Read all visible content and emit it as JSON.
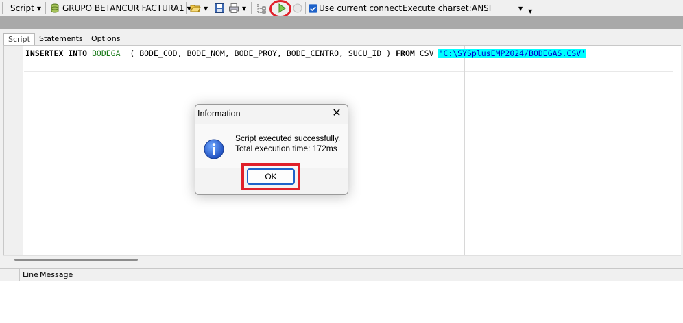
{
  "toolbar": {
    "script_menu": "Script",
    "database_name": "GRUPO BETANCUR FACTURA1",
    "use_current_connect": "Use current connect",
    "execute_charset_label": "Execute charset:",
    "charset_value": "ANSI",
    "highlight_color": "#e0202a"
  },
  "tabs": [
    {
      "label": "Script",
      "active": true
    },
    {
      "label": "Statements",
      "active": false
    },
    {
      "label": "Options",
      "active": false
    }
  ],
  "editor": {
    "kw1": "INSERTEX",
    "kw2": "INTO",
    "table": "BODEGA",
    "columns": "  ( BODE_COD, BODE_NOM, BODE_PROY, BODE_CENTRO, SUCU_ID )",
    "kw3": "FROM",
    "format": "CSV",
    "path": "'C:\\SYSplusEMP2024/BODEGAS.CSV'"
  },
  "messages": {
    "col_line": "Line",
    "col_message": "Message"
  },
  "dialog": {
    "title": "Information",
    "line1": "Script executed successfully.",
    "line2": "Total execution time: 172ms",
    "ok_label": "OK"
  }
}
